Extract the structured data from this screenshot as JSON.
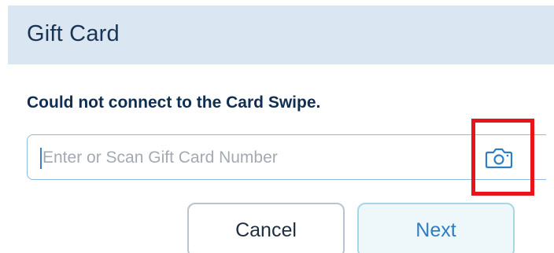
{
  "header": {
    "title": "Gift Card"
  },
  "message": {
    "error": "Could not connect to the Card Swipe."
  },
  "card_input": {
    "placeholder": "Enter or Scan Gift Card Number",
    "value": ""
  },
  "icons": {
    "scan": "camera-icon"
  },
  "buttons": {
    "cancel_label": "Cancel",
    "next_label": "Next"
  },
  "colors": {
    "header_bg": "#dae6f1",
    "accent": "#2f7dc3",
    "highlight": "#e8141c"
  }
}
